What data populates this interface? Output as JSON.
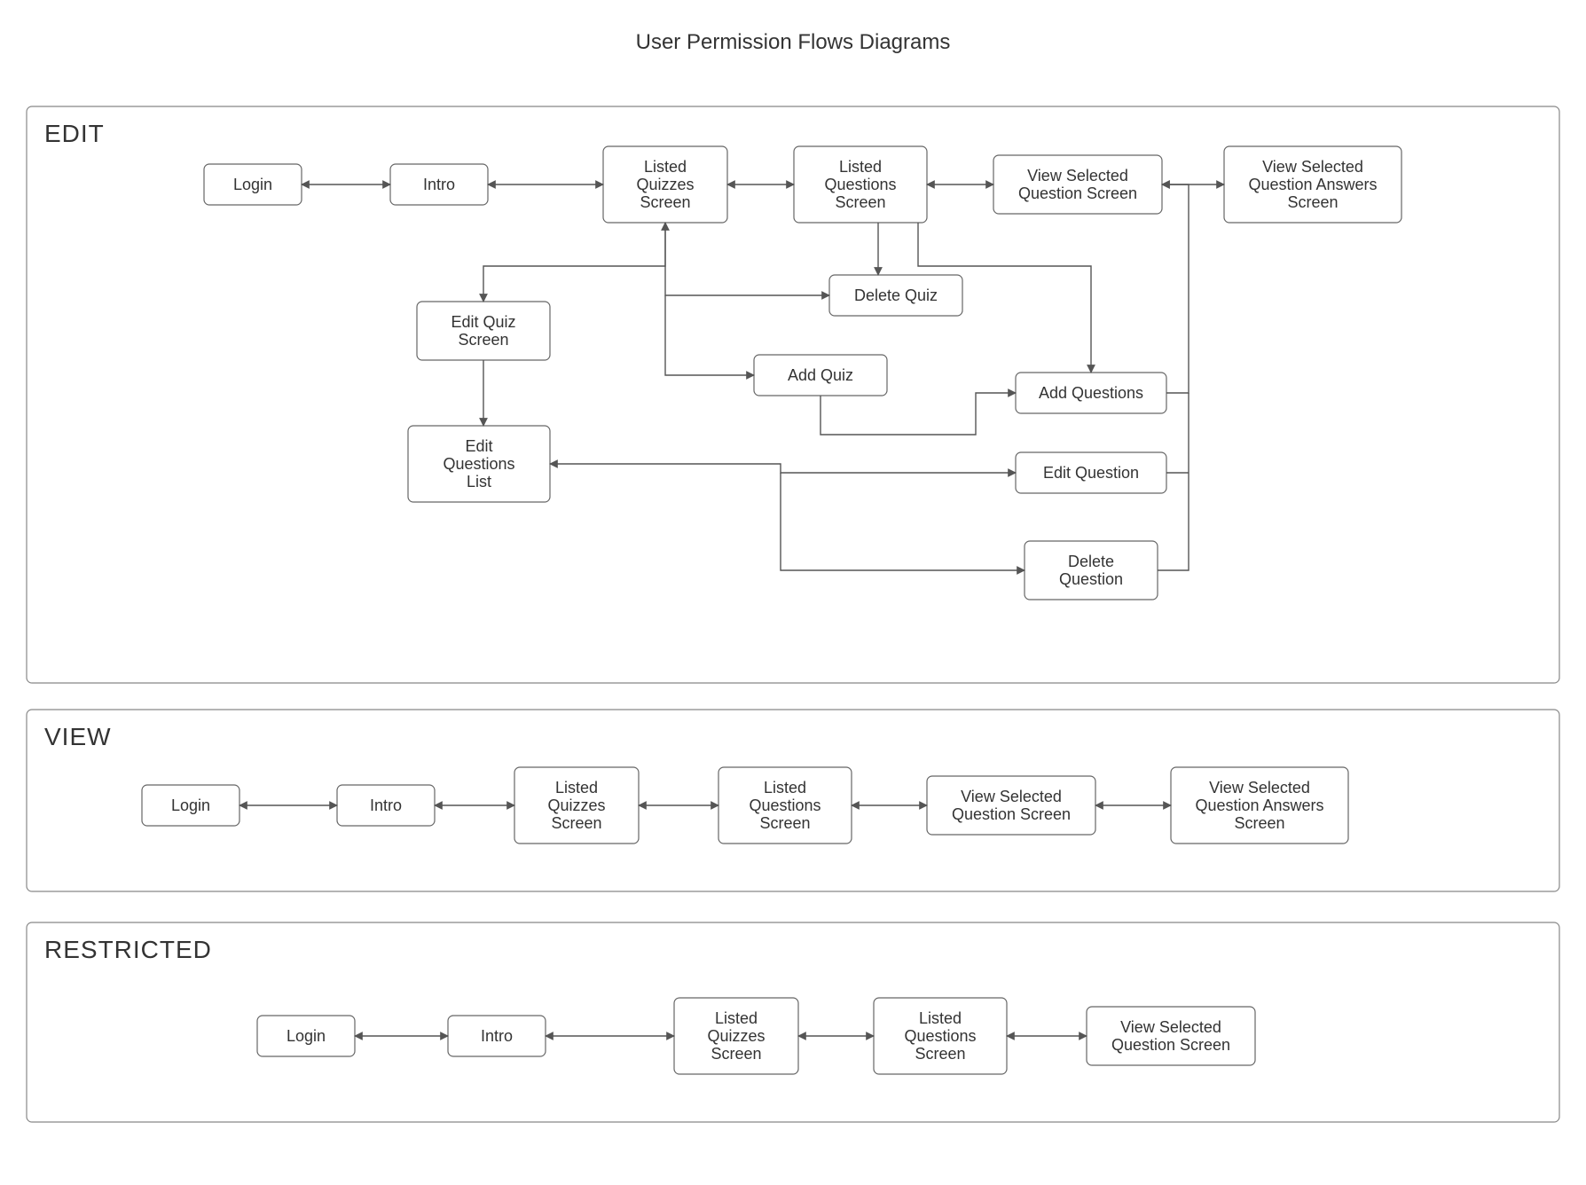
{
  "title": "User Permission Flows Diagrams",
  "sections": {
    "edit": {
      "label": "EDIT"
    },
    "view": {
      "label": "VIEW"
    },
    "restricted": {
      "label": "RESTRICTED"
    }
  },
  "nodes": {
    "login": "Login",
    "intro": "Intro",
    "listed_quizzes": "Listed\nQuizzes\nScreen",
    "listed_questions": "Listed\nQuestions\nScreen",
    "view_sel_q": "View Selected\nQuestion Screen",
    "view_sel_qa": "View Selected\nQuestion Answers\nScreen",
    "edit_quiz": "Edit Quiz\nScreen",
    "edit_q_list": "Edit\nQuestions\nList",
    "delete_quiz": "Delete Quiz",
    "add_quiz": "Add Quiz",
    "add_questions": "Add Questions",
    "edit_question": "Edit Question",
    "delete_question": "Delete\nQuestion"
  },
  "edges": {
    "edit_main_row": [
      [
        "login",
        "intro"
      ],
      [
        "intro",
        "listed_quizzes"
      ],
      [
        "listed_quizzes",
        "listed_questions"
      ],
      [
        "listed_questions",
        "view_sel_q"
      ],
      [
        "view_sel_q",
        "view_sel_qa"
      ]
    ],
    "edit_extra": [
      [
        "listed_quizzes",
        "edit_quiz",
        "down-left-bidir"
      ],
      [
        "edit_quiz",
        "edit_q_list",
        "down"
      ],
      [
        "listed_quizzes",
        "delete_quiz",
        "right-branch"
      ],
      [
        "listed_quizzes",
        "add_quiz",
        "right-branch"
      ],
      [
        "listed_questions",
        "delete_quiz",
        "down"
      ],
      [
        "add_quiz",
        "add_questions",
        "right-up"
      ],
      [
        "listed_questions",
        "add_questions",
        "down-up"
      ],
      [
        "edit_q_list",
        "edit_question",
        "right-bidir"
      ],
      [
        "edit_q_list",
        "delete_question",
        "right-branch"
      ],
      [
        "add_questions",
        "view_sel_q",
        "right-up"
      ],
      [
        "edit_question",
        "view_sel_q",
        "right-up"
      ],
      [
        "delete_question",
        "view_sel_q",
        "right-up"
      ]
    ],
    "view_row": [
      [
        "login",
        "intro"
      ],
      [
        "intro",
        "listed_quizzes"
      ],
      [
        "listed_quizzes",
        "listed_questions"
      ],
      [
        "listed_questions",
        "view_sel_q"
      ],
      [
        "view_sel_q",
        "view_sel_qa"
      ]
    ],
    "restricted_row": [
      [
        "login",
        "intro"
      ],
      [
        "intro",
        "listed_quizzes"
      ],
      [
        "listed_quizzes",
        "listed_questions"
      ],
      [
        "listed_questions",
        "view_sel_q"
      ]
    ]
  }
}
